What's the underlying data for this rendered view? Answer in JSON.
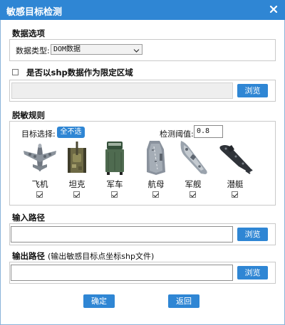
{
  "window": {
    "title": "敏感目标检测"
  },
  "data_options": {
    "section_title": "数据选项",
    "type_label": "数据类型:",
    "type_value": "DOM数据"
  },
  "shp_region": {
    "checkbox_label": "是否以shp数据作为限定区域",
    "path_value": "",
    "browse_label": "浏览"
  },
  "rules": {
    "section_title": "脱敏规则",
    "target_select_label": "目标选择:",
    "deselect_all_label": "全不选",
    "threshold_label": "检测阈值:",
    "threshold_value": "0.8",
    "targets": [
      {
        "label": "飞机",
        "icon": "airplane-icon",
        "checked": true
      },
      {
        "label": "坦克",
        "icon": "tank-icon",
        "checked": true
      },
      {
        "label": "军车",
        "icon": "military-truck-icon",
        "checked": true
      },
      {
        "label": "航母",
        "icon": "aircraft-carrier-icon",
        "checked": true
      },
      {
        "label": "军舰",
        "icon": "warship-icon",
        "checked": true
      },
      {
        "label": "潜艇",
        "icon": "submarine-icon",
        "checked": true
      }
    ]
  },
  "input_path": {
    "section_title": "输入路径",
    "value": "",
    "browse_label": "浏览"
  },
  "output_path": {
    "section_title": "输出路径",
    "hint": "(输出敏感目标点坐标shp文件)",
    "value": "",
    "browse_label": "浏览"
  },
  "footer": {
    "confirm_label": "确定",
    "back_label": "返回"
  },
  "colors": {
    "titlebar": "#2f86d4",
    "button": "#2f86d4",
    "button_text": "#ffffff"
  }
}
